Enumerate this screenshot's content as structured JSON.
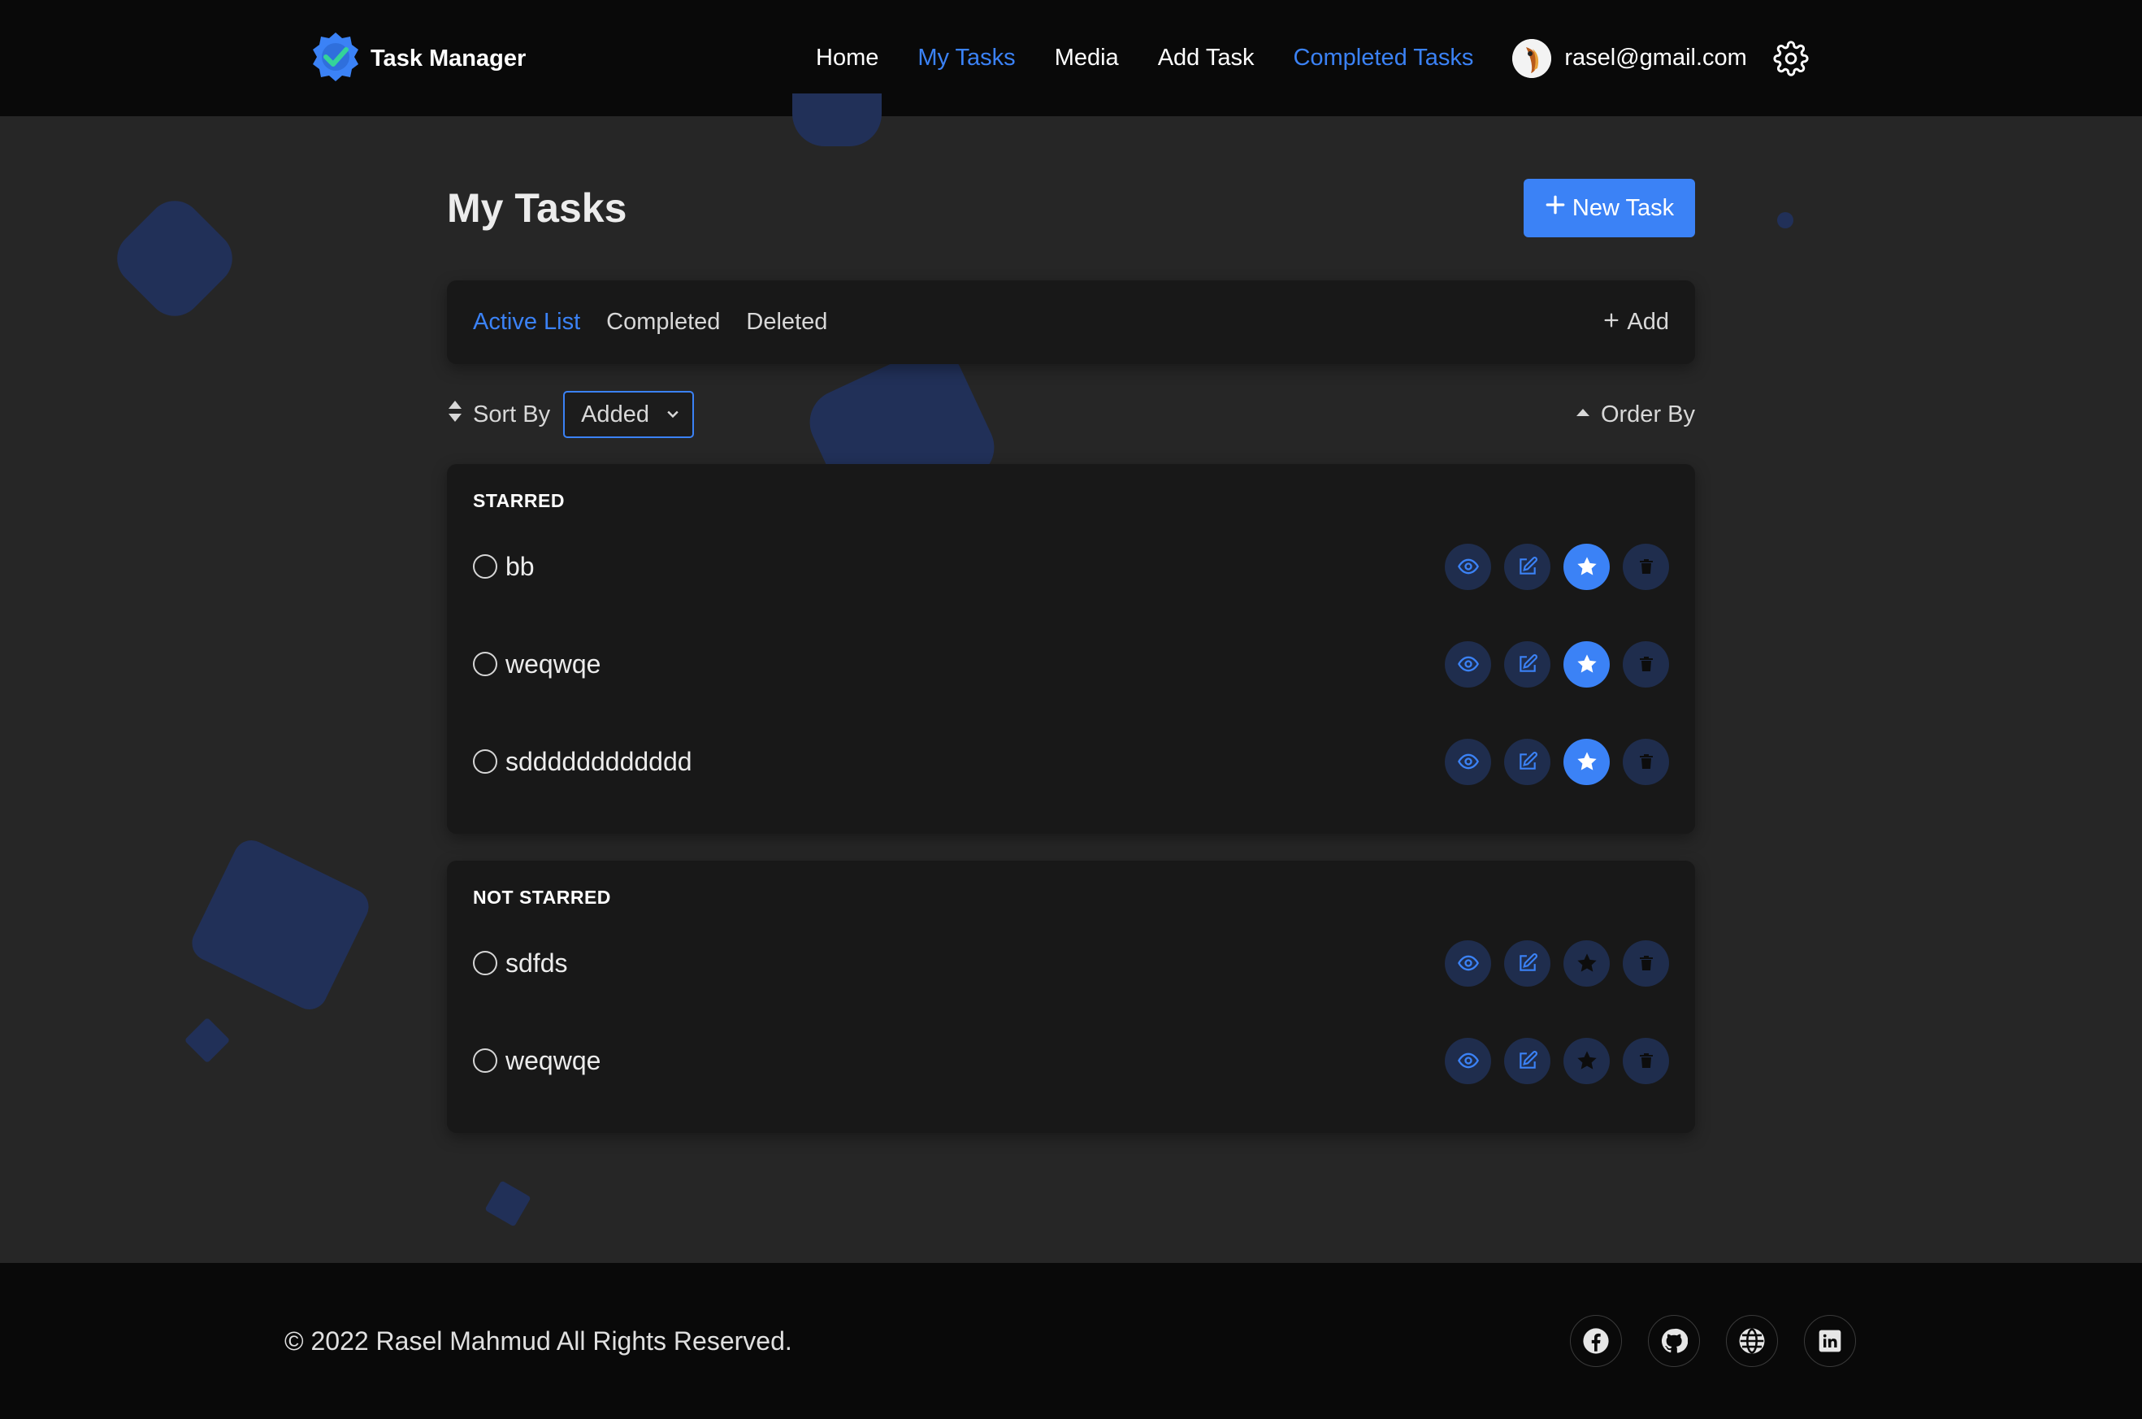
{
  "brand": {
    "name": "Task Manager",
    "logo_icon": "gear-check-logo"
  },
  "nav": {
    "links": [
      {
        "label": "Home",
        "active": false
      },
      {
        "label": "My Tasks",
        "active": true
      },
      {
        "label": "Media",
        "active": false
      },
      {
        "label": "Add Task",
        "active": false
      },
      {
        "label": "Completed Tasks",
        "active": true
      }
    ],
    "user_email": "rasel@gmail.com",
    "settings_icon": "gear-icon"
  },
  "page": {
    "title": "My Tasks",
    "new_task_label": "New Task"
  },
  "tabs": {
    "items": [
      {
        "label": "Active List",
        "active": true
      },
      {
        "label": "Completed",
        "active": false
      },
      {
        "label": "Deleted",
        "active": false
      }
    ],
    "add_label": "Add"
  },
  "sort": {
    "label": "Sort By",
    "selected": "Added",
    "order_label": "Order By"
  },
  "groups": [
    {
      "title": "STARRED",
      "tasks": [
        {
          "title": "bb",
          "starred": true
        },
        {
          "title": "weqwqe",
          "starred": true
        },
        {
          "title": "sdddddddddddd",
          "starred": true
        }
      ]
    },
    {
      "title": "NOT STARRED",
      "tasks": [
        {
          "title": "sdfds",
          "starred": false
        },
        {
          "title": "weqwqe",
          "starred": false
        }
      ]
    }
  ],
  "footer": {
    "copyright": "© 2022 Rasel Mahmud All Rights Reserved.",
    "socials": [
      "facebook-icon",
      "github-icon",
      "globe-icon",
      "linkedin-icon"
    ]
  },
  "colors": {
    "accent": "#3b82f6",
    "background": "#262626",
    "navbar": "#090909",
    "card": "#181818",
    "shape": "#213058"
  }
}
